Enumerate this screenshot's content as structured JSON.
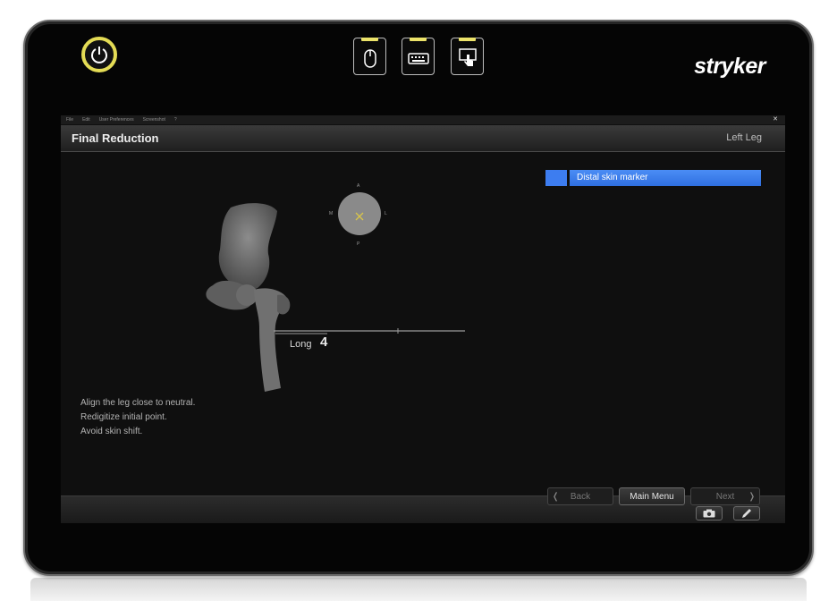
{
  "device": {
    "brand": "stryker",
    "hardware_buttons": [
      {
        "name": "mouse-mode",
        "icon": "mouse-icon"
      },
      {
        "name": "keyboard-mode",
        "icon": "keyboard-icon"
      },
      {
        "name": "touch-mode",
        "icon": "touch-icon"
      }
    ],
    "led_color": "#ece36a",
    "power_ring_color": "#e4dc55"
  },
  "app": {
    "menu": [
      "File",
      "Edit",
      "User Preferences",
      "Screenshot",
      "?"
    ],
    "title": "Final Reduction",
    "side": "Left Leg",
    "marker": {
      "label": "Distal skin marker",
      "color": "#3d7df0"
    },
    "compass": {
      "top": "A",
      "bottom": "P",
      "left": "M",
      "right": "L"
    },
    "measure": {
      "label": "Long",
      "value": "4"
    },
    "instructions": [
      "Align the leg close to neutral.",
      "Redigitize initial point.",
      "Avoid skin shift."
    ],
    "nav": {
      "back": "Back",
      "main_menu": "Main Menu",
      "next": "Next"
    },
    "tools": [
      {
        "icon": "camera-icon"
      },
      {
        "icon": "pen-icon"
      }
    ]
  }
}
